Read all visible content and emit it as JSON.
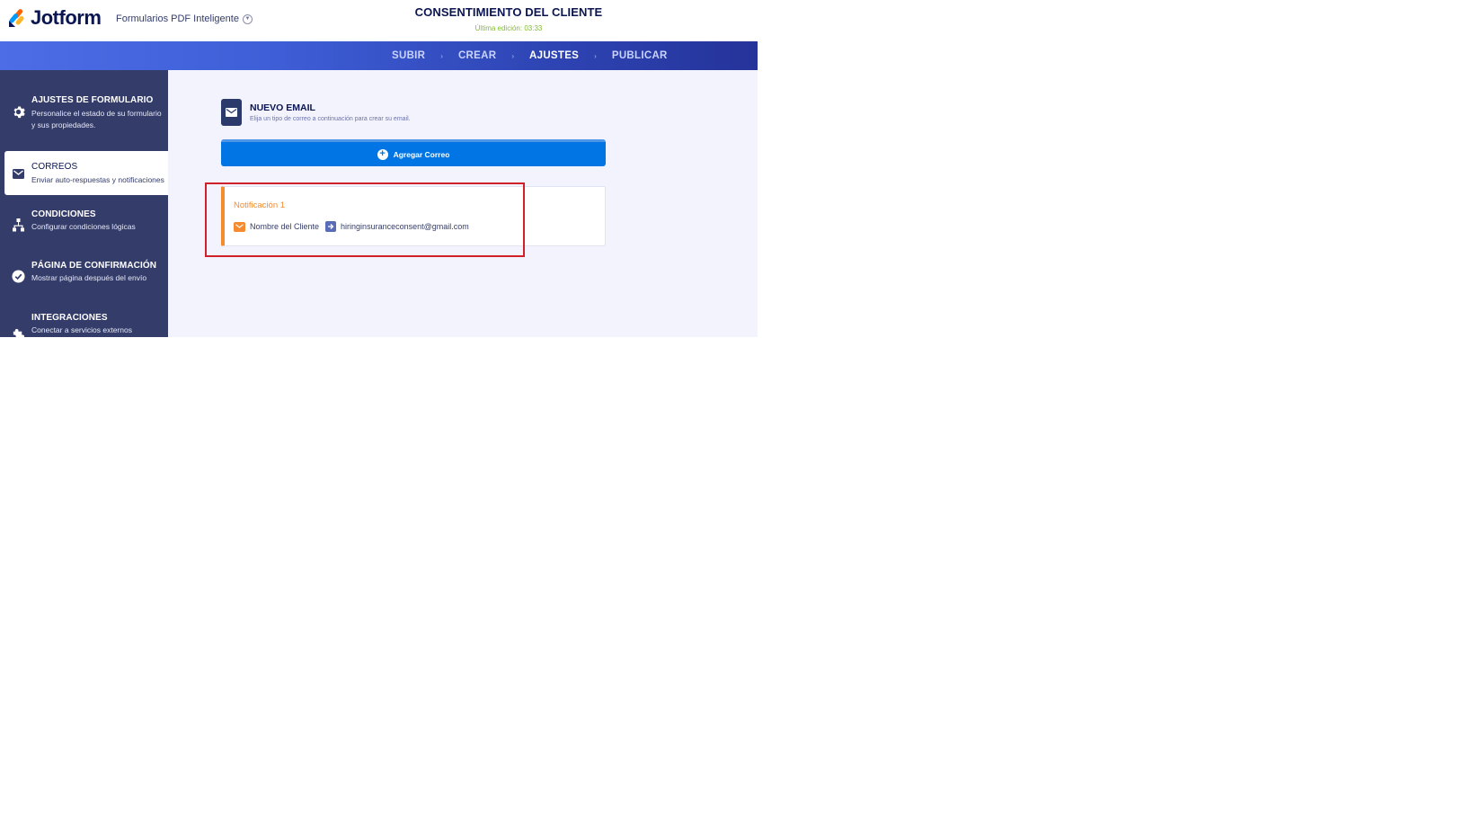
{
  "header": {
    "logo_text": "Jotform",
    "product_label": "Formularios PDF Inteligente",
    "form_title": "CONSENTIMIENTO DEL CLIENTE",
    "last_edit": "Última edición: 03:33"
  },
  "nav": {
    "items": [
      {
        "label": "SUBIR",
        "active": false
      },
      {
        "label": "CREAR",
        "active": false
      },
      {
        "label": "AJUSTES",
        "active": true
      },
      {
        "label": "PUBLICAR",
        "active": false
      }
    ],
    "separator": "›"
  },
  "sidebar": {
    "items": [
      {
        "icon": "gear-icon",
        "title": "AJUSTES DE FORMULARIO",
        "desc": "Personalice el estado de su formulario y sus propiedades."
      },
      {
        "icon": "envelope-icon",
        "title": "CORREOS",
        "desc": "Enviar auto-respuestas y notificaciones"
      },
      {
        "icon": "conditions-icon",
        "title": "CONDICIONES",
        "desc": "Configurar condiciones lógicas"
      },
      {
        "icon": "check-badge-icon",
        "title": "PÁGINA DE CONFIRMACIÓN",
        "desc": "Mostrar página después del envío"
      },
      {
        "icon": "puzzle-icon",
        "title": "INTEGRACIONES",
        "desc": "Conectar a servicios externos"
      }
    ]
  },
  "main": {
    "new_email": {
      "title": "NUEVO EMAIL",
      "desc": "Elija un tipo de correo a continuación para crear su email."
    },
    "add_button_label": "Agregar Correo",
    "notification": {
      "title": "Notificación 1",
      "from": "Nombre del Cliente",
      "to": "hiringinsuranceconsent@gmail.com"
    }
  },
  "colors": {
    "sidebar_bg": "#343c6a",
    "accent_blue": "#0075e3",
    "notification_orange": "#f58b2e",
    "highlight_red": "#d0202a"
  }
}
